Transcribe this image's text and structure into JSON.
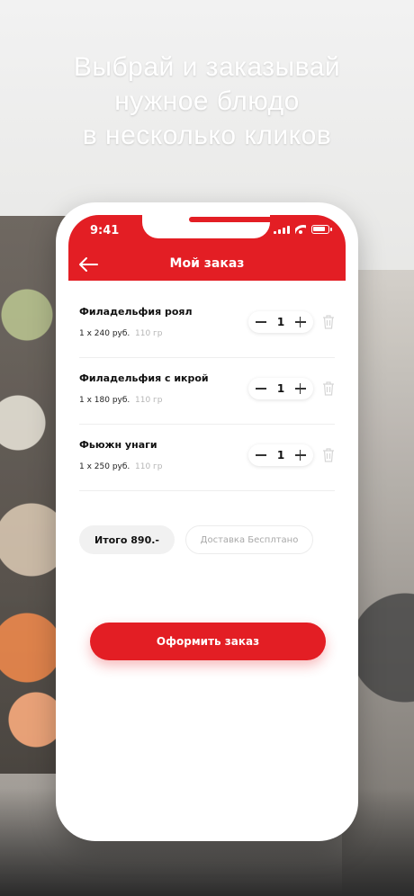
{
  "headline": {
    "line1": "Выбрай и заказывай",
    "line2": "нужное блюдо",
    "line3": "в несколько кликов"
  },
  "status_bar": {
    "time": "9:41"
  },
  "appbar": {
    "title": "Мой заказ",
    "back_icon": "arrow-left-icon"
  },
  "items": [
    {
      "name": "Филадельфия роял",
      "price": "1 x 240 руб.",
      "weight": "110 гр",
      "quantity": "1"
    },
    {
      "name": "Филадельфия с икрой",
      "price": "1 x 180  руб.",
      "weight": "110 гр",
      "quantity": "1"
    },
    {
      "name": "Фьюжн унаги",
      "price": "1 x 250  руб.",
      "weight": "110 гр",
      "quantity": "1"
    }
  ],
  "summary": {
    "total": "Итого 890.-",
    "delivery": "Доставка Бесплтано"
  },
  "order_button": {
    "label": "Оформить заказ"
  },
  "colors": {
    "accent": "#e31e24"
  }
}
